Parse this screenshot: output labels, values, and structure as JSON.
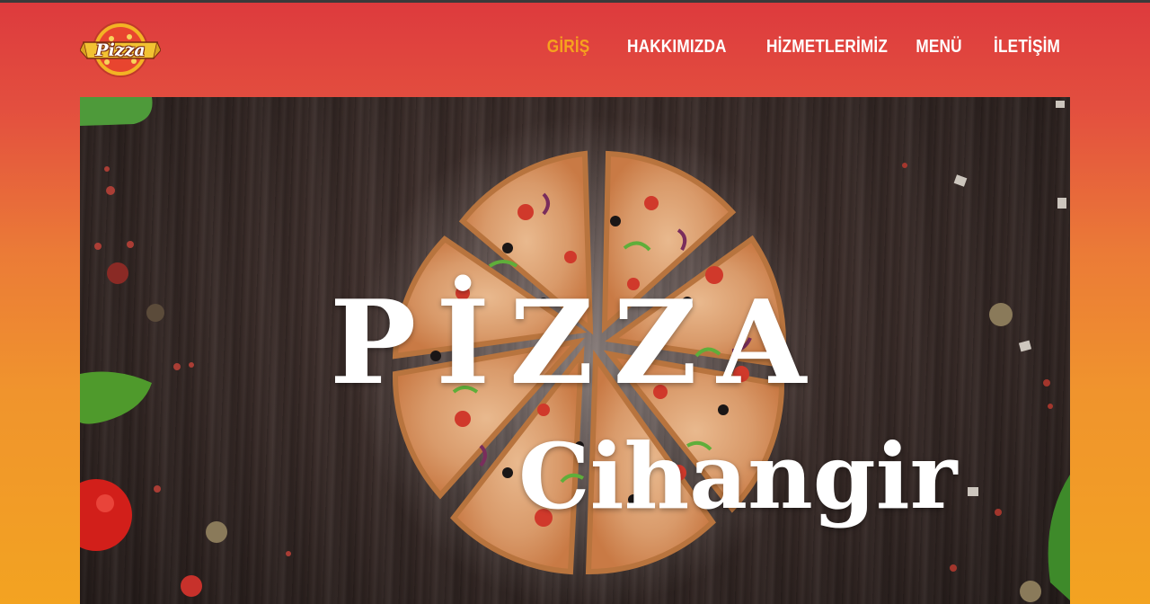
{
  "header": {
    "logo_text": "Pizza",
    "nav": [
      {
        "label": "GİRİŞ",
        "active": true
      },
      {
        "label": "HAKKIMIZDA",
        "active": false
      },
      {
        "label": "HİZMETLERİMİZ",
        "active": false
      },
      {
        "label": "MENÜ",
        "active": false
      },
      {
        "label": "İLETİŞİM",
        "active": false
      }
    ]
  },
  "hero": {
    "title_line1": "PİZZA",
    "title_line2": "Cihangir"
  },
  "colors": {
    "nav_active": "#f6a21e",
    "nav_text": "#ffffff",
    "gradient_top": "#dd3a3d",
    "gradient_bottom": "#f3a321"
  }
}
